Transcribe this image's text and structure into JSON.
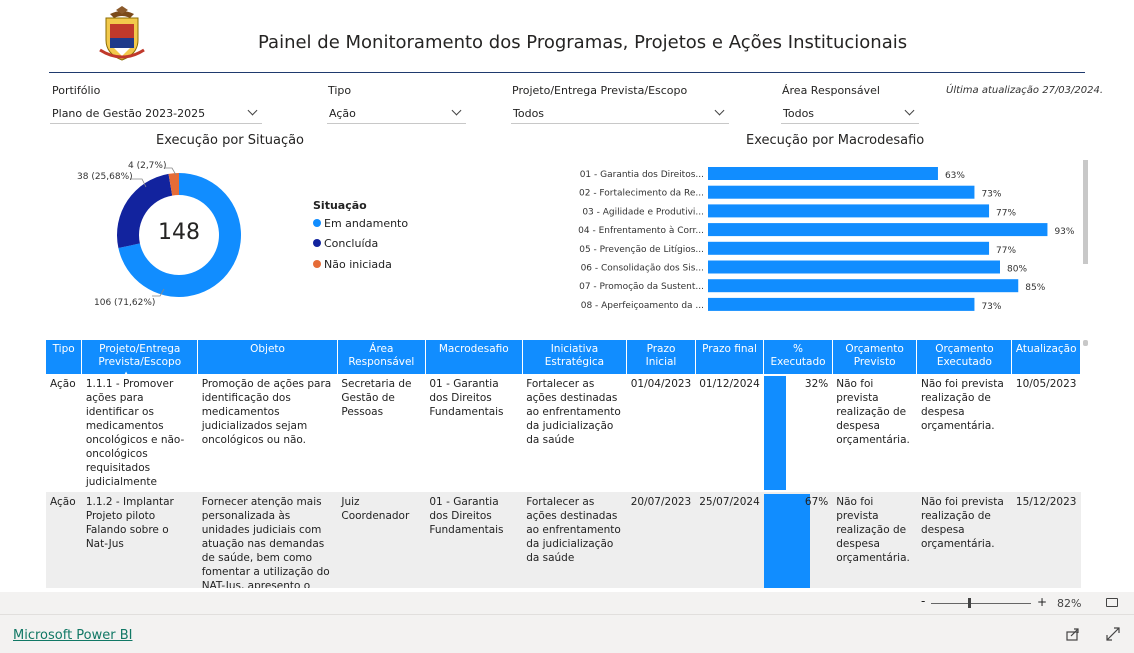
{
  "header": {
    "title": "Painel de Monitoramento dos Programas, Projetos e Ações Institucionais",
    "last_update": "Última atualização 27/03/2024."
  },
  "filters": [
    {
      "label": "Portifólio",
      "value": "Plano de Gestão 2023-2025"
    },
    {
      "label": "Tipo",
      "value": "Ação"
    },
    {
      "label": "Projeto/Entrega Prevista/Escopo",
      "value": "Todos"
    },
    {
      "label": "Área Responsável",
      "value": "Todos"
    }
  ],
  "donut": {
    "title": "Execução por Situação",
    "total": "148",
    "legend_title": "Situação",
    "segments": [
      {
        "name": "Em andamento",
        "value": 106,
        "label": "106 (71,62%)",
        "color": "#118dff"
      },
      {
        "name": "Concluída",
        "value": 38,
        "label": "38 (25,68%)",
        "color": "#12239e"
      },
      {
        "name": "Não iniciada",
        "value": 4,
        "label": "4 (2,7%)",
        "color": "#e66c37"
      }
    ]
  },
  "chart_data": {
    "type": "bar",
    "title": "Execução por Macrodesafio",
    "categories": [
      "01 - Garantia dos Direitos...",
      "02 - Fortalecimento da Re...",
      "03 - Agilidade e Produtivi...",
      "04 - Enfrentamento à Corr...",
      "05 - Prevenção de Litígios...",
      "06 - Consolidação dos Sis...",
      "07 - Promoção da Sustent...",
      "08 - Aperfeiçoamento da ..."
    ],
    "values": [
      63,
      73,
      77,
      93,
      77,
      80,
      85,
      73
    ],
    "value_labels": [
      "63%",
      "73%",
      "77%",
      "93%",
      "77%",
      "80%",
      "85%",
      "73%"
    ],
    "xlim": [
      0,
      100
    ],
    "color": "#118dff"
  },
  "table": {
    "columns": [
      "Tipo",
      "Projeto/Entrega Prevista/Escopo",
      "Objeto",
      "Área Responsável",
      "Macrodesafio",
      "Iniciativa Estratégica",
      "Prazo Inicial",
      "Prazo final",
      "% Executado",
      "Orçamento Previsto",
      "Orçamento Executado",
      "Atualização"
    ],
    "rows": [
      {
        "tipo": "Ação",
        "projeto": "1.1.1 - Promover ações para identificar os medicamentos oncológicos e não-oncológicos requisitados judicialmente",
        "objeto": "Promoção de ações para identificação dos medicamentos judicializados sejam oncológicos ou não.",
        "area": "Secretaria de Gestão de Pessoas",
        "macro": "01 - Garantia dos Direitos Fundamentais",
        "iniciativa": "Fortalecer as ações destinadas ao enfrentamento da judicialização da saúde",
        "inicio": "01/04/2023",
        "fim": "01/12/2024",
        "pct": 32,
        "pct_label": "32%",
        "orc_prev": "Não foi prevista realização de despesa orçamentária.",
        "orc_exec": "Não foi prevista realização de despesa orçamentária.",
        "atualizacao": "10/05/2023"
      },
      {
        "tipo": "Ação",
        "projeto": "1.1.2 - Implantar Projeto piloto Falando sobre o Nat-Jus",
        "objeto": "Fornecer atenção mais personalizada às unidades judiciais com atuação nas demandas de saúde, bem como fomentar a utilização do NAT-Jus, apresento o projeto \"Falando sobre",
        "area": "Juiz Coordenador",
        "macro": "01 - Garantia dos Direitos Fundamentais",
        "iniciativa": "Fortalecer as ações destinadas ao enfrentamento da judicialização da saúde",
        "inicio": "20/07/2023",
        "fim": "25/07/2024",
        "pct": 67,
        "pct_label": "67%",
        "orc_prev": "Não foi prevista realização de despesa orçamentária.",
        "orc_exec": "Não foi prevista realização de despesa orçamentária.",
        "atualizacao": "15/12/2023"
      }
    ]
  },
  "footer": {
    "brand": "Microsoft Power BI",
    "zoom": "82%",
    "zoom_minus": "-",
    "zoom_plus": "+"
  }
}
